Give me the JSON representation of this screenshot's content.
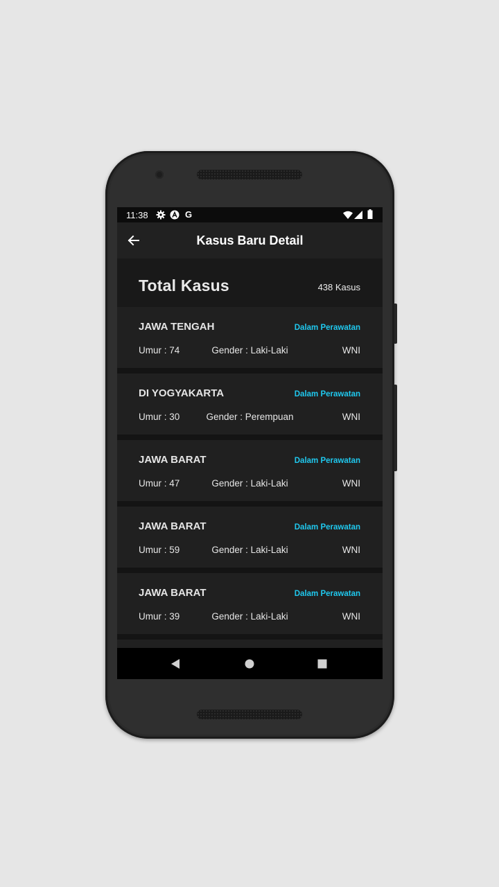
{
  "status_bar": {
    "time": "11:38",
    "icons_left": [
      "gear-icon",
      "a-badge-icon",
      "g-icon"
    ],
    "g_letter": "G",
    "icons_right": [
      "wifi-icon",
      "signal-icon",
      "battery-icon"
    ]
  },
  "app_bar": {
    "title": "Kasus Baru Detail",
    "back_icon": "arrow-left-icon"
  },
  "summary": {
    "label": "Total Kasus",
    "value": "438 Kasus"
  },
  "cases": [
    {
      "province": "JAWA TENGAH",
      "status": "Dalam Perawatan",
      "age": "Umur : 74",
      "gender": "Gender : Laki-Laki",
      "nationality": "WNI"
    },
    {
      "province": "DI YOGYAKARTA",
      "status": "Dalam Perawatan",
      "age": "Umur : 30",
      "gender": "Gender : Perempuan",
      "nationality": "WNI"
    },
    {
      "province": "JAWA BARAT",
      "status": "Dalam Perawatan",
      "age": "Umur : 47",
      "gender": "Gender : Laki-Laki",
      "nationality": "WNI"
    },
    {
      "province": "JAWA BARAT",
      "status": "Dalam Perawatan",
      "age": "Umur : 59",
      "gender": "Gender : Laki-Laki",
      "nationality": "WNI"
    },
    {
      "province": "JAWA BARAT",
      "status": "Dalam Perawatan",
      "age": "Umur : 39",
      "gender": "Gender : Laki-Laki",
      "nationality": "WNI"
    }
  ],
  "nav_bar": {
    "buttons": [
      "back-triangle-icon",
      "home-circle-icon",
      "recents-square-icon"
    ]
  },
  "colors": {
    "status_accent": "#1fc8ee",
    "background": "#141414",
    "card": "#202020",
    "app_bar": "#212121"
  }
}
